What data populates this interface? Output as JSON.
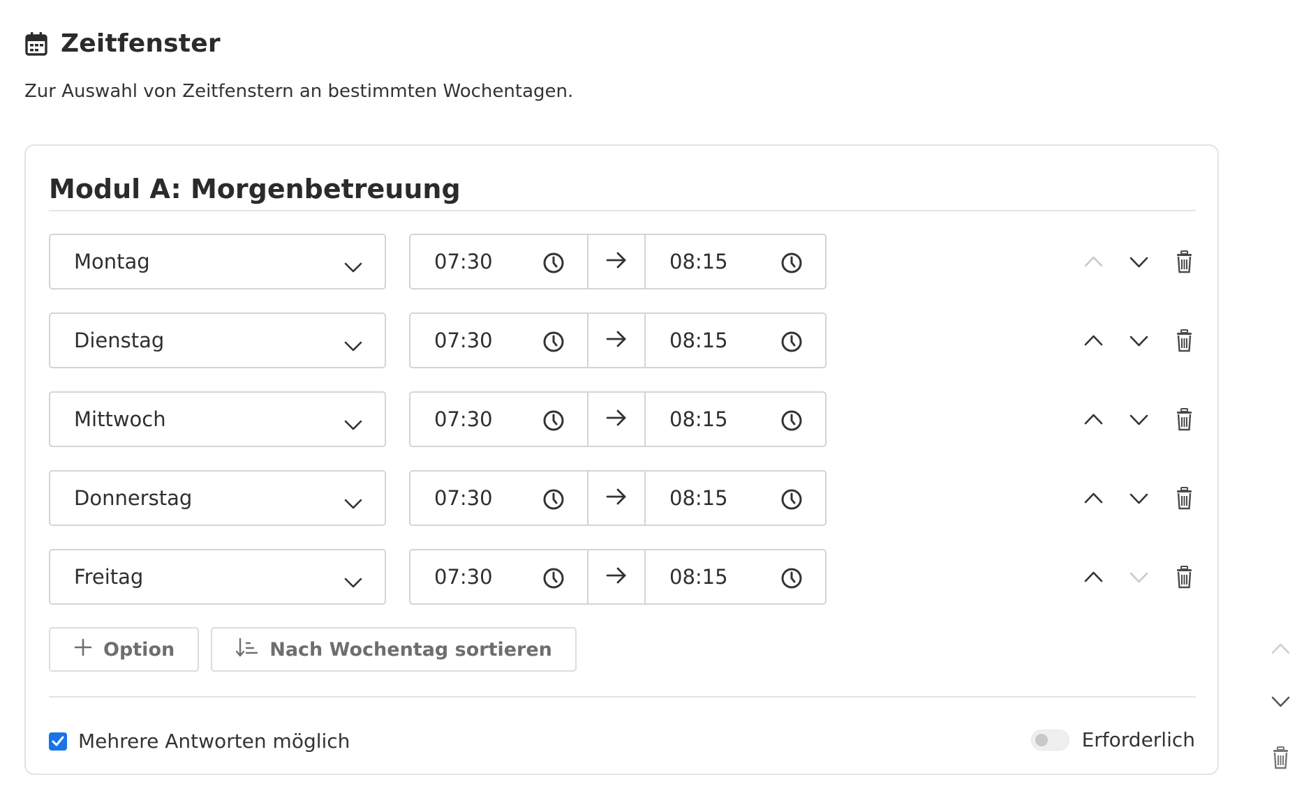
{
  "header": {
    "title": "Zeitfenster",
    "icon": "calendar-icon",
    "subtitle": "Zur Auswahl von Zeitfenstern an bestimmten Wochentagen."
  },
  "card": {
    "title": "Modul A: Morgenbetreuung"
  },
  "rows": [
    {
      "day": "Montag",
      "start": "07:30",
      "end": "08:15",
      "up_enabled": false,
      "down_enabled": true
    },
    {
      "day": "Dienstag",
      "start": "07:30",
      "end": "08:15",
      "up_enabled": true,
      "down_enabled": true
    },
    {
      "day": "Mittwoch",
      "start": "07:30",
      "end": "08:15",
      "up_enabled": true,
      "down_enabled": true
    },
    {
      "day": "Donnerstag",
      "start": "07:30",
      "end": "08:15",
      "up_enabled": true,
      "down_enabled": true
    },
    {
      "day": "Freitag",
      "start": "07:30",
      "end": "08:15",
      "up_enabled": true,
      "down_enabled": false
    }
  ],
  "buttons": {
    "add_option": "Option",
    "sort": "Nach Wochentag sortieren"
  },
  "footer": {
    "multiple_answers_label": "Mehrere Antworten möglich",
    "multiple_answers_checked": true,
    "required_label": "Erforderlich",
    "required_on": false
  },
  "colors": {
    "accent": "#1a73e8",
    "icon_dark": "#333333",
    "icon_disabled": "#c4c4c4",
    "border": "#d4d4d4"
  }
}
